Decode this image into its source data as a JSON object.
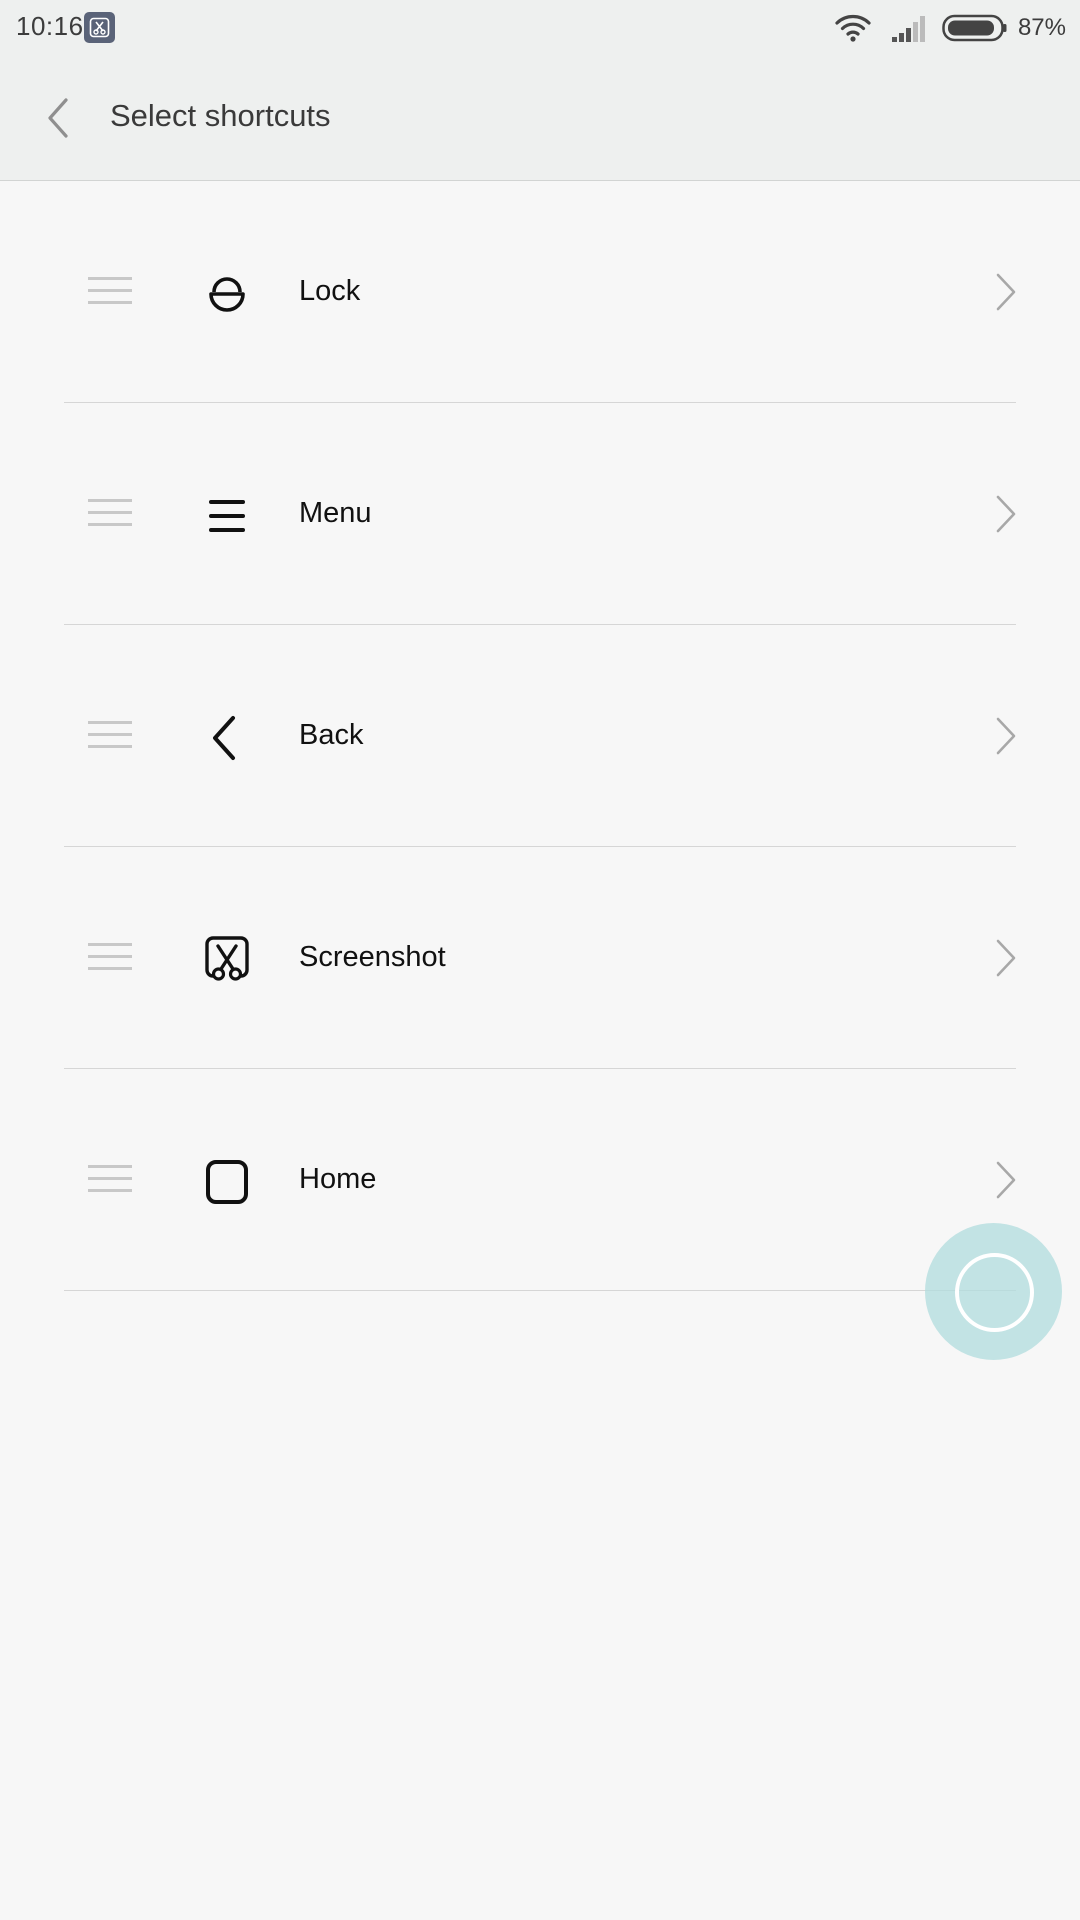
{
  "status_bar": {
    "time": "10:16",
    "battery_percent": "87%",
    "app_icon": "screenshot-icon"
  },
  "header": {
    "title": "Select shortcuts",
    "back_icon": "chevron-left-icon"
  },
  "shortcuts": [
    {
      "label": "Lock",
      "icon": "lock-icon"
    },
    {
      "label": "Menu",
      "icon": "menu-icon"
    },
    {
      "label": "Back",
      "icon": "back-icon"
    },
    {
      "label": "Screenshot",
      "icon": "screenshot-icon"
    },
    {
      "label": "Home",
      "icon": "home-icon"
    }
  ],
  "colors": {
    "background": "#f7f7f7",
    "header_bg": "#eef0ef",
    "divider": "#d6d6d6",
    "floating_button": "#b0dcdd"
  }
}
